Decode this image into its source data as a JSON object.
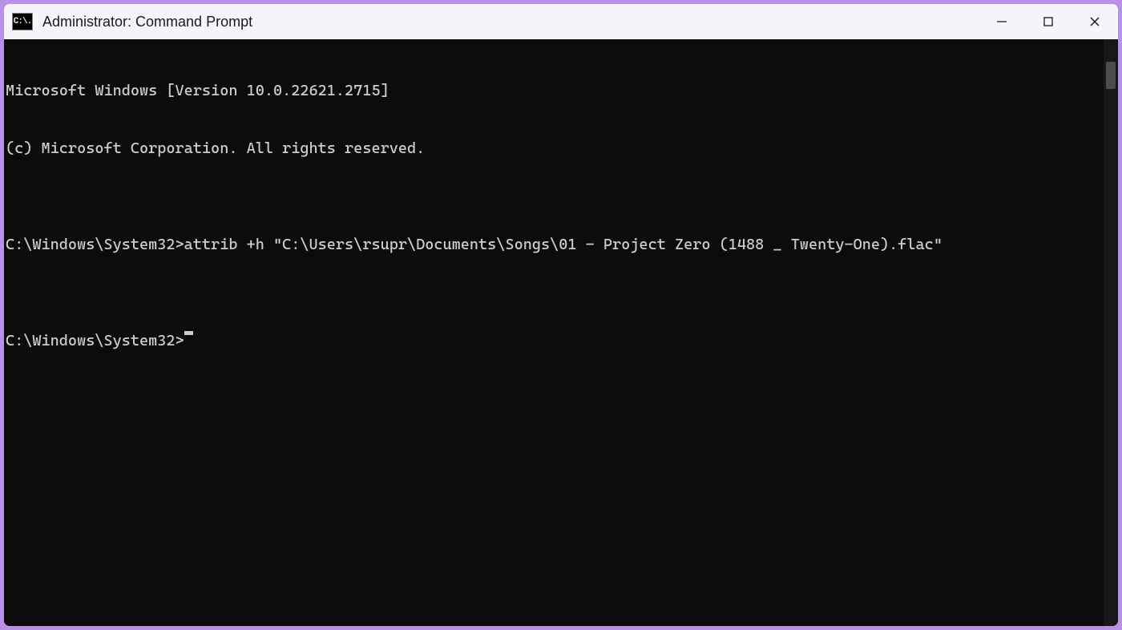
{
  "window": {
    "title": "Administrator: Command Prompt"
  },
  "terminal": {
    "lines": [
      "Microsoft Windows [Version 10.0.22621.2715]",
      "(c) Microsoft Corporation. All rights reserved.",
      "",
      "C:\\Windows\\System32>attrib +h \"C:\\Users\\rsupr\\Documents\\Songs\\01 - Project Zero (1488 _ Twenty-One).flac\"",
      ""
    ],
    "current_prompt": "C:\\Windows\\System32>",
    "current_input": ""
  },
  "icons": {
    "app": "cmd-icon",
    "minimize": "minimize-icon",
    "maximize": "maximize-icon",
    "close": "close-icon"
  }
}
